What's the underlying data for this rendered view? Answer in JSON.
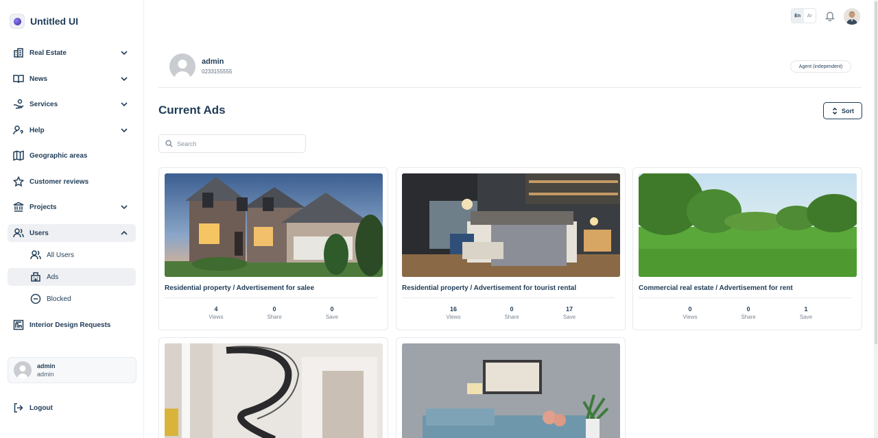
{
  "brand": {
    "name": "Untitled UI"
  },
  "sidebar": {
    "items": [
      {
        "label": "Real Estate",
        "icon": "building-icon"
      },
      {
        "label": "News",
        "icon": "book-open-icon"
      },
      {
        "label": "Services",
        "icon": "hand-coins-icon"
      },
      {
        "label": "Help",
        "icon": "user-help-icon"
      },
      {
        "label": "Geographic areas",
        "icon": "map-icon"
      },
      {
        "label": "Customer reviews",
        "icon": "star-icon"
      },
      {
        "label": "Projects",
        "icon": "bank-icon"
      },
      {
        "label": "Users",
        "icon": "users-icon"
      }
    ],
    "users_sub": [
      {
        "label": "All Users"
      },
      {
        "label": "Ads"
      },
      {
        "label": "Blocked"
      }
    ],
    "interior": {
      "label": "Interior Design Requests"
    },
    "user_card": {
      "name": "admin",
      "role": "admin"
    },
    "logout": {
      "label": "Logout"
    }
  },
  "topbar": {
    "lang_en": "En",
    "lang_ar": "Ar"
  },
  "profile": {
    "name": "admin",
    "phone": "0233155555",
    "role": "Agent (independent)"
  },
  "page": {
    "title": "Current Ads",
    "sort_label": "Sort",
    "search_placeholder": "Search"
  },
  "cards": [
    {
      "title": "Residential property / Advertisement for salee",
      "views": "4",
      "share": "0",
      "save": "0"
    },
    {
      "title": "Residential property / Advertisement for tourist rental",
      "views": "16",
      "share": "0",
      "save": "17"
    },
    {
      "title": "Commercial real estate / Advertisement for rent",
      "views": "0",
      "share": "0",
      "save": "1"
    },
    {
      "title": ""
    },
    {
      "title": ""
    }
  ],
  "stat_labels": {
    "views": "Views",
    "share": "Share",
    "save": "Save"
  },
  "colors": {
    "primary_text": "#1f3b57",
    "muted": "#7a8694",
    "border": "#e6e9ee",
    "active_bg": "#eef0f3"
  }
}
